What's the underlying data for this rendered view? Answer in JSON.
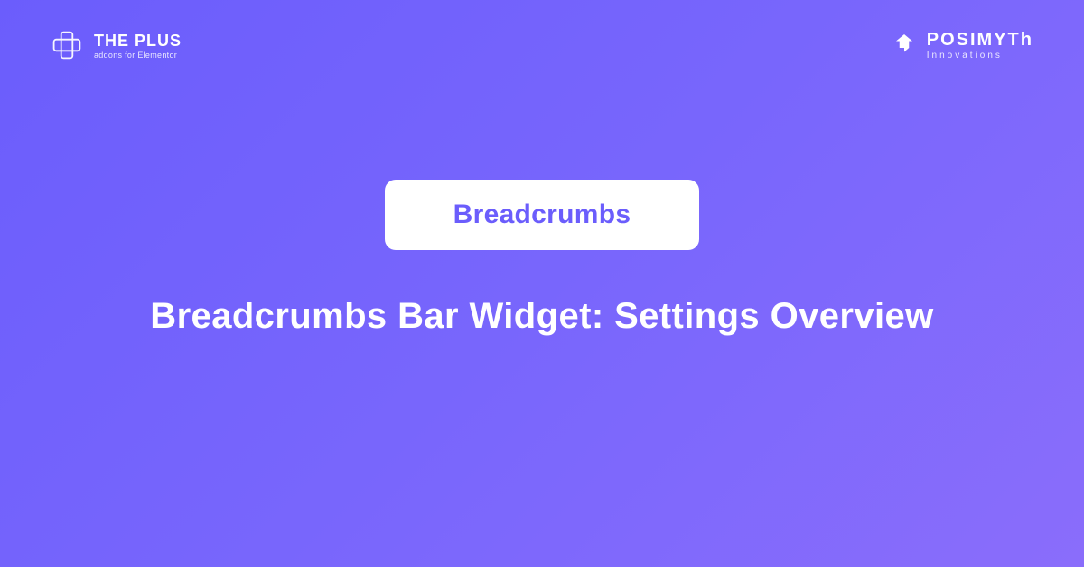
{
  "header": {
    "left": {
      "title": "THE PLUS",
      "subtitle": "addons for Elementor"
    },
    "right": {
      "title": "POSIMYTh",
      "subtitle": "Innovations"
    }
  },
  "center": {
    "badge": "Breadcrumbs",
    "title": "Breadcrumbs Bar Widget: Settings Overview"
  }
}
